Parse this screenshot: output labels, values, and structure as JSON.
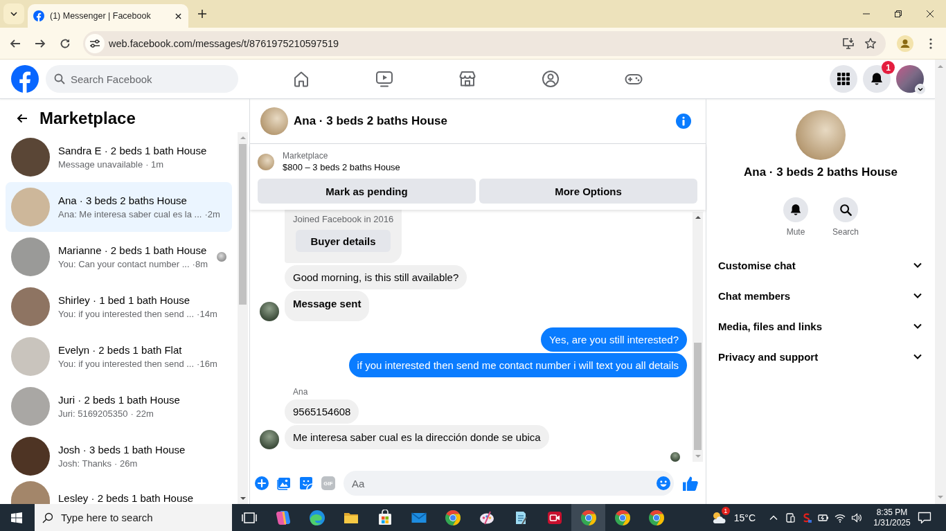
{
  "browser": {
    "tabs": [
      {
        "title": "(1) Messenger | Facebook",
        "selected": true
      }
    ],
    "url": "web.facebook.com/messages/t/8761975210597519"
  },
  "fb_header": {
    "search": {
      "placeholder": "Search Facebook"
    },
    "nav": [
      {
        "kind": "home",
        "selected": false
      },
      {
        "kind": "video",
        "selected": false
      },
      {
        "kind": "marketplace",
        "selected": false
      },
      {
        "kind": "groups",
        "selected": false
      },
      {
        "kind": "gaming",
        "selected": false
      }
    ],
    "notifications_badge": "1"
  },
  "sidebar": {
    "title": "Marketplace",
    "conversations": [
      {
        "title": "Sandra E · 2 beds 1 bath House",
        "preview": "Message unavailable",
        "time": "· 1m",
        "selected": false,
        "read_receipt": false
      },
      {
        "title": "Ana · 3 beds 2 baths House",
        "preview": "Ana: Me interesa saber cual es la ...",
        "time": "·2m",
        "selected": true,
        "read_receipt": false
      },
      {
        "title": "Marianne · 2 beds 1 bath House",
        "preview": "You: Can your contact number ...",
        "time": "·8m",
        "selected": false,
        "read_receipt": true
      },
      {
        "title": "Shirley · 1 bed 1 bath House",
        "preview": "You: if you interested then send ...",
        "time": "·14m",
        "selected": false,
        "read_receipt": false
      },
      {
        "title": "Evelyn · 2 beds 1 bath Flat",
        "preview": "You: if you interested then send ...",
        "time": "·16m",
        "selected": false,
        "read_receipt": false
      },
      {
        "title": "Juri · 2 beds 1 bath House",
        "preview": "Juri: 5169205350",
        "time": "· 22m",
        "selected": false,
        "read_receipt": false
      },
      {
        "title": "Josh · 3 beds 1 bath House",
        "preview": "Josh: Thanks",
        "time": "· 26m",
        "selected": false,
        "read_receipt": false
      },
      {
        "title": "Lesley · 2 beds 1 bath House",
        "selected": false,
        "read_receipt": false
      }
    ]
  },
  "chat": {
    "title": "Ana · 3 beds 2 baths House",
    "listing": {
      "source": "Marketplace",
      "title": "$800 – 3 beds 2 baths House",
      "buttons": [
        "Mark as pending",
        "More Options"
      ]
    },
    "messages": [
      {
        "kind": "buyer_card",
        "text": "Joined Facebook in 2016",
        "button": "Buyer details"
      },
      {
        "kind": "incoming",
        "text": "Good morning, is this still available?",
        "avatar": false,
        "bold": false
      },
      {
        "kind": "incoming",
        "text": "Message sent",
        "avatar": true,
        "bold": true
      },
      {
        "kind": "outgoing",
        "text": "Yes, are you still interested?",
        "avatar": false,
        "bold": false
      },
      {
        "kind": "outgoing",
        "text": "if you interested then send me contact number i will text you all details",
        "avatar": false,
        "bold": false
      },
      {
        "kind": "sender",
        "text": "Ana"
      },
      {
        "kind": "incoming",
        "text": "9565154608",
        "avatar": false,
        "bold": false
      },
      {
        "kind": "incoming",
        "text": "Me interesa saber cual es la dirección donde se ubica",
        "avatar": true,
        "bold": false
      }
    ],
    "seen": true,
    "composer": {
      "gif_label": "GIF",
      "placeholder": "Aa"
    }
  },
  "details": {
    "name": "Ana · 3 beds 2 baths House",
    "actions": [
      {
        "kind": "mute",
        "label": "Mute"
      },
      {
        "kind": "search",
        "label": "Search"
      }
    ],
    "sections": [
      {
        "label": "Customise chat",
        "expanded": false
      },
      {
        "label": "Chat members",
        "expanded": false
      },
      {
        "label": "Media, files and links",
        "expanded": false
      },
      {
        "label": "Privacy and support",
        "expanded": false
      }
    ]
  },
  "taskbar": {
    "search": {
      "placeholder": "Type here to search"
    },
    "apps": [
      {
        "kind": "task_view",
        "active": false
      },
      {
        "kind": "assistant",
        "active": false
      },
      {
        "kind": "wave_browser",
        "active": false
      },
      {
        "kind": "folder",
        "active": false
      },
      {
        "kind": "store",
        "active": false
      },
      {
        "kind": "mail",
        "active": false
      },
      {
        "kind": "browser",
        "active": false
      },
      {
        "kind": "palette",
        "active": false
      },
      {
        "kind": "notepad",
        "active": false
      },
      {
        "kind": "recorder",
        "active": false
      },
      {
        "kind": "browser",
        "active": true
      },
      {
        "kind": "browser",
        "active": false
      },
      {
        "kind": "browser",
        "active": false
      }
    ],
    "weather": {
      "temperature": "15°C",
      "badge": "1"
    },
    "clock": {
      "time": "8:35 PM",
      "date": "1/31/2025"
    }
  }
}
